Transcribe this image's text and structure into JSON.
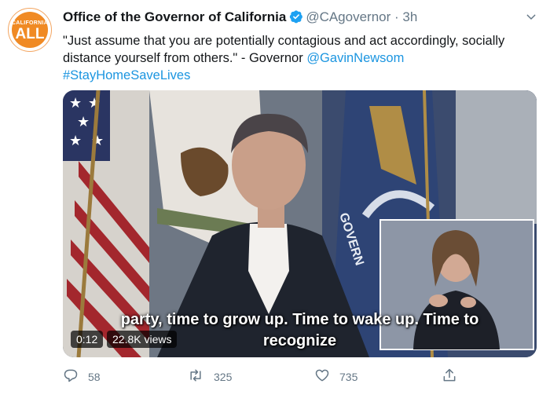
{
  "account": {
    "avatar_small_text": "CALIFORNIA",
    "avatar_big_text": "ALL",
    "name": "Office of the Governor of California",
    "handle": "@CAgovernor",
    "separator": "·",
    "time": "3h"
  },
  "tweet": {
    "text": "\"Just assume that you are potentially contagious and act accordingly, socially distance yourself from others.\" - Governor ",
    "mention": "@GavinNewsom",
    "hashtag": "#StayHomeSaveLives"
  },
  "video": {
    "caption_line1": "party, time to grow up. Time to wake up. Time to",
    "caption_line2": "recognize",
    "elapsed": "0:12",
    "views": "22.8K views",
    "flag_text": "GOVERN"
  },
  "actions": {
    "replies": "58",
    "retweets": "325",
    "likes": "735"
  },
  "colors": {
    "accent": "#1b95e0",
    "muted": "#657786",
    "brand_orange": "#f08a24"
  }
}
